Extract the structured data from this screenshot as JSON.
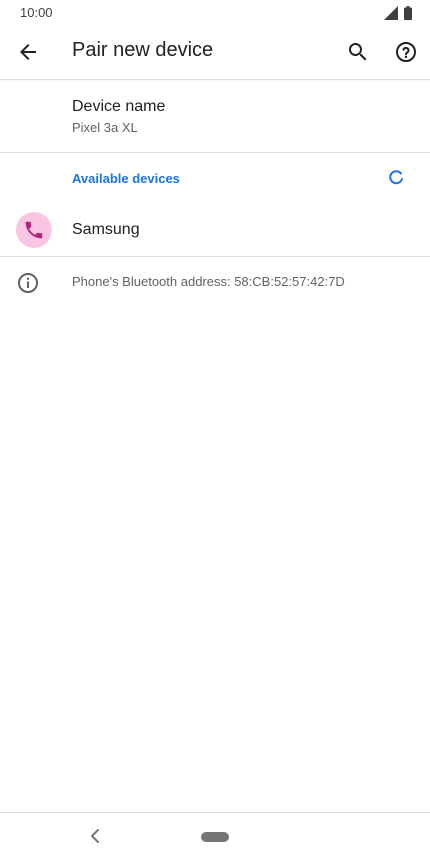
{
  "status_bar": {
    "time": "10:00",
    "icons": [
      "cellular-signal-icon",
      "battery-icon"
    ]
  },
  "app_bar": {
    "title": "Pair new device",
    "icons": [
      "back-arrow-icon",
      "search-icon",
      "help-icon"
    ]
  },
  "device_name": {
    "title": "Device name",
    "value": "Pixel 3a XL"
  },
  "available_devices": {
    "header": "Available devices",
    "items": [
      {
        "label": "Samsung",
        "icon": "phone-icon"
      }
    ]
  },
  "info": {
    "text": "Phone's Bluetooth address: 58:CB:52:57:42:7D",
    "icon": "info-icon"
  },
  "colors": {
    "accent": "#1a73e8",
    "device_icon_bg": "#f8c6e2",
    "device_icon_fg": "#b0257a"
  }
}
